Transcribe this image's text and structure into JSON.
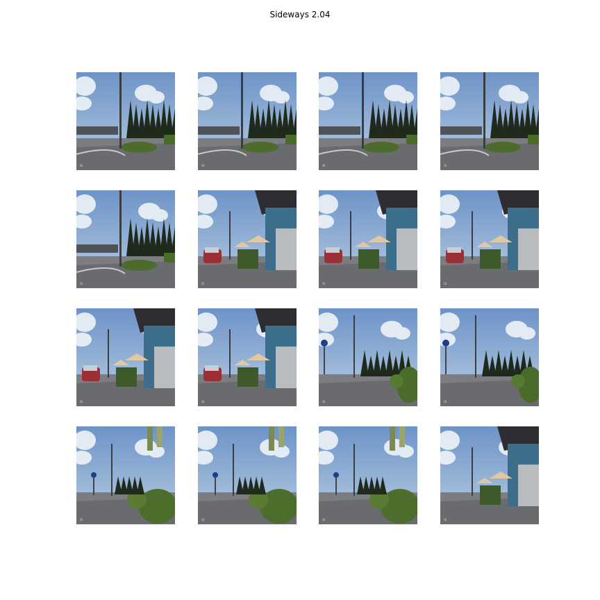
{
  "figure": {
    "title": "Sideways 2.04"
  },
  "frames": [
    {
      "row": 1,
      "col": 1,
      "scene": "roundabout-trees",
      "watermark": "mapillary"
    },
    {
      "row": 1,
      "col": 2,
      "scene": "roundabout-trees",
      "watermark": "mapillary"
    },
    {
      "row": 1,
      "col": 3,
      "scene": "roundabout-trees",
      "watermark": "mapillary"
    },
    {
      "row": 1,
      "col": 4,
      "scene": "roundabout-trees",
      "watermark": "mapillary"
    },
    {
      "row": 2,
      "col": 1,
      "scene": "roundabout-trees",
      "watermark": "mapillary"
    },
    {
      "row": 2,
      "col": 2,
      "scene": "storefront-umbrellas",
      "watermark": "mapillary"
    },
    {
      "row": 2,
      "col": 3,
      "scene": "storefront-umbrellas",
      "watermark": "mapillary"
    },
    {
      "row": 2,
      "col": 4,
      "scene": "storefront-umbrellas",
      "watermark": "mapillary"
    },
    {
      "row": 3,
      "col": 1,
      "scene": "storefront-car",
      "watermark": "mapillary"
    },
    {
      "row": 3,
      "col": 2,
      "scene": "storefront-car",
      "watermark": "mapillary"
    },
    {
      "row": 3,
      "col": 3,
      "scene": "street-sign-bushes",
      "watermark": "mapillary"
    },
    {
      "row": 3,
      "col": 4,
      "scene": "street-sign-bushes",
      "watermark": "mapillary"
    },
    {
      "row": 4,
      "col": 1,
      "scene": "flags-bushes",
      "watermark": "mapillary"
    },
    {
      "row": 4,
      "col": 2,
      "scene": "flags-bushes",
      "watermark": "mapillary"
    },
    {
      "row": 4,
      "col": 3,
      "scene": "flags-bushes",
      "watermark": "mapillary"
    },
    {
      "row": 4,
      "col": 4,
      "scene": "flags-storefront",
      "watermark": "mapillary"
    }
  ]
}
